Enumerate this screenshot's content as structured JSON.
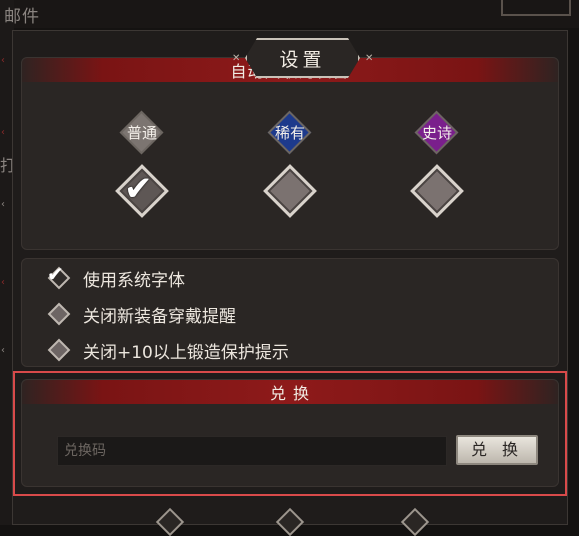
{
  "background": {
    "mail_label": "邮件",
    "side_char": "打"
  },
  "window": {
    "title": "设置"
  },
  "auto_recycle": {
    "header": "自动回收的装备",
    "rarities": [
      {
        "label": "普通",
        "color": "#7c7571",
        "checked": true
      },
      {
        "label": "稀有",
        "color": "#1d3a8c",
        "checked": false
      },
      {
        "label": "史诗",
        "color": "#7a1f8c",
        "checked": false
      }
    ]
  },
  "options": [
    {
      "label": "使用系统字体",
      "checked": true
    },
    {
      "label": "关闭新装备穿戴提醒",
      "checked": false
    },
    {
      "label": "关闭+10以上锻造保护提示",
      "checked": false
    }
  ],
  "redeem": {
    "header": "兑 换",
    "placeholder": "兑换码",
    "button_label": "兑 换"
  }
}
